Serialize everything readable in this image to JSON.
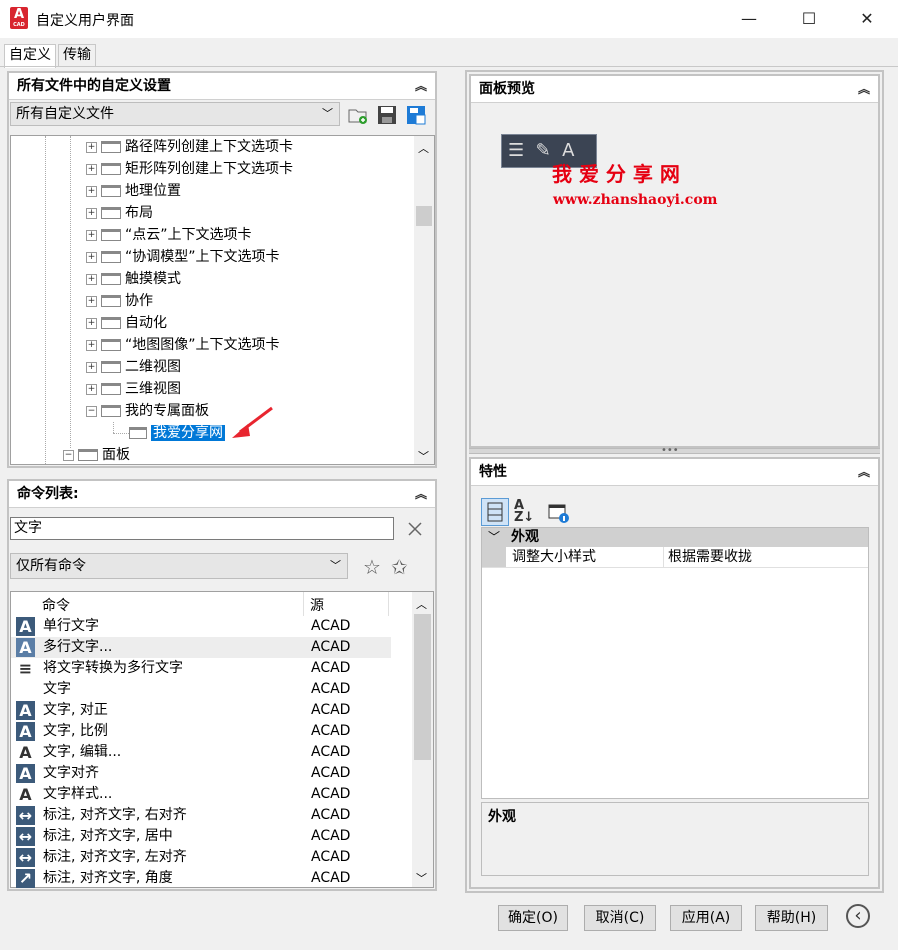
{
  "window": {
    "title": "自定义用户界面",
    "app_logo": "A",
    "app_logo_sub": "CAD",
    "minimize": "—",
    "maximize": "☐",
    "close": "✕"
  },
  "tabs": [
    {
      "label": "自定义"
    },
    {
      "label": "传输"
    }
  ],
  "custom_panel": {
    "title": "所有文件中的自定义设置",
    "file_combo": "所有自定义文件",
    "tree": [
      {
        "label": "路径阵列创建上下文选项卡"
      },
      {
        "label": "矩形阵列创建上下文选项卡"
      },
      {
        "label": "地理位置"
      },
      {
        "label": "布局"
      },
      {
        "label": "“点云”上下文选项卡"
      },
      {
        "label": "“协调模型”上下文选项卡"
      },
      {
        "label": "触摸模式"
      },
      {
        "label": "协作"
      },
      {
        "label": "自动化"
      },
      {
        "label": "“地图图像”上下文选项卡"
      },
      {
        "label": "二维视图"
      },
      {
        "label": "三维视图"
      },
      {
        "label": "我的专属面板"
      }
    ],
    "selected_item": "我爱分享网",
    "panels_node": "面板"
  },
  "command_panel": {
    "title": "命令列表:",
    "search_value": "文字",
    "filter_combo": "仅所有命令",
    "col_command": "命令",
    "col_source": "源",
    "commands": [
      {
        "name": "单行文字",
        "source": "ACAD",
        "icon": "A"
      },
      {
        "name": "多行文字...",
        "source": "ACAD",
        "icon": "A"
      },
      {
        "name": "将文字转换为多行文字",
        "source": "ACAD",
        "icon": "≡"
      },
      {
        "name": "文字",
        "source": "ACAD",
        "icon": ""
      },
      {
        "name": "文字, 对正",
        "source": "ACAD",
        "icon": "A"
      },
      {
        "name": "文字, 比例",
        "source": "ACAD",
        "icon": "A"
      },
      {
        "name": "文字, 编辑...",
        "source": "ACAD",
        "icon": "A"
      },
      {
        "name": "文字对齐",
        "source": "ACAD",
        "icon": "A"
      },
      {
        "name": "文字样式...",
        "source": "ACAD",
        "icon": "A"
      },
      {
        "name": "标注, 对齐文字, 右对齐",
        "source": "ACAD",
        "icon": "↔"
      },
      {
        "name": "标注, 对齐文字, 居中",
        "source": "ACAD",
        "icon": "↔"
      },
      {
        "name": "标注, 对齐文字, 左对齐",
        "source": "ACAD",
        "icon": "↔"
      },
      {
        "name": "标注, 对齐文字, 角度",
        "source": "ACAD",
        "icon": "↗"
      }
    ]
  },
  "preview_panel": {
    "title": "面板预览",
    "toolbar_icons": "☰  ✎  A",
    "watermark_text": "我 爱 分 享 网",
    "watermark_url": "www.zhanshaoyi.com"
  },
  "properties_panel": {
    "title": "特性",
    "category": "外观",
    "prop_name": "调整大小样式",
    "prop_value": "根据需要收拢",
    "description_title": "外观"
  },
  "buttons": {
    "ok": "确定(O)",
    "cancel": "取消(C)",
    "apply": "应用(A)",
    "help": "帮助(H)",
    "collapse": "‹"
  },
  "colors": {
    "selection": "#0078d7",
    "watermark": "#e60012",
    "preview_bg": "#f0f0f0"
  }
}
